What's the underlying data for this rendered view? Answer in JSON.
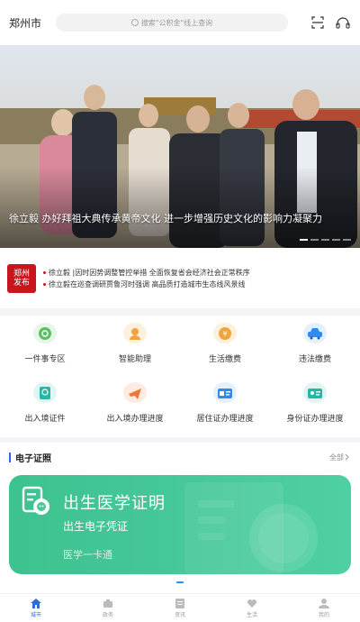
{
  "header": {
    "city": "郑州市",
    "search_placeholder": "搜索\"公积金\"线上查询"
  },
  "banner": {
    "caption": "徐立毅 办好拜祖大典传承黄帝文化 进一步增强历史文化的影响力凝聚力",
    "active_dot": 0,
    "dot_count": 5
  },
  "news": {
    "logo_line1": "郑州",
    "logo_line2": "发布",
    "items": [
      "徐立毅 |因时因势调整管控举措 全面恢复省会经济社会正常秩序",
      "徐立毅在巡查调研贾鲁河时强调 高品质打造城市生态线风景线"
    ]
  },
  "services": [
    {
      "label": "一件事专区",
      "icon": "one-thing-icon",
      "color": "#4caf50"
    },
    {
      "label": "智能助理",
      "icon": "assistant-icon",
      "color": "#f0a441"
    },
    {
      "label": "生活缴费",
      "icon": "payment-icon",
      "color": "#f0a441"
    },
    {
      "label": "违法缴费",
      "icon": "car-icon",
      "color": "#2d8cf0"
    },
    {
      "label": "出入境证件",
      "icon": "passport-icon",
      "color": "#26b7a6"
    },
    {
      "label": "出入境办理进度",
      "icon": "plane-icon",
      "color": "#f0763b"
    },
    {
      "label": "居住证办理进度",
      "icon": "residence-card-icon",
      "color": "#2d8cf0"
    },
    {
      "label": "身份证办理进度",
      "icon": "id-card-icon",
      "color": "#26b7a6"
    }
  ],
  "section": {
    "title": "电子证照",
    "more": "全部"
  },
  "card": {
    "title": "出生医学证明",
    "subtitle": "出生电子凭证",
    "note": "医学一卡通",
    "color": "#45c797"
  },
  "tabs": [
    {
      "label": "城市",
      "icon": "home-icon",
      "active": true
    },
    {
      "label": "政务",
      "icon": "government-icon",
      "active": false
    },
    {
      "label": "资讯",
      "icon": "news-icon",
      "active": false
    },
    {
      "label": "生活",
      "icon": "heart-icon",
      "active": false
    },
    {
      "label": "我的",
      "icon": "user-icon",
      "active": false
    }
  ]
}
